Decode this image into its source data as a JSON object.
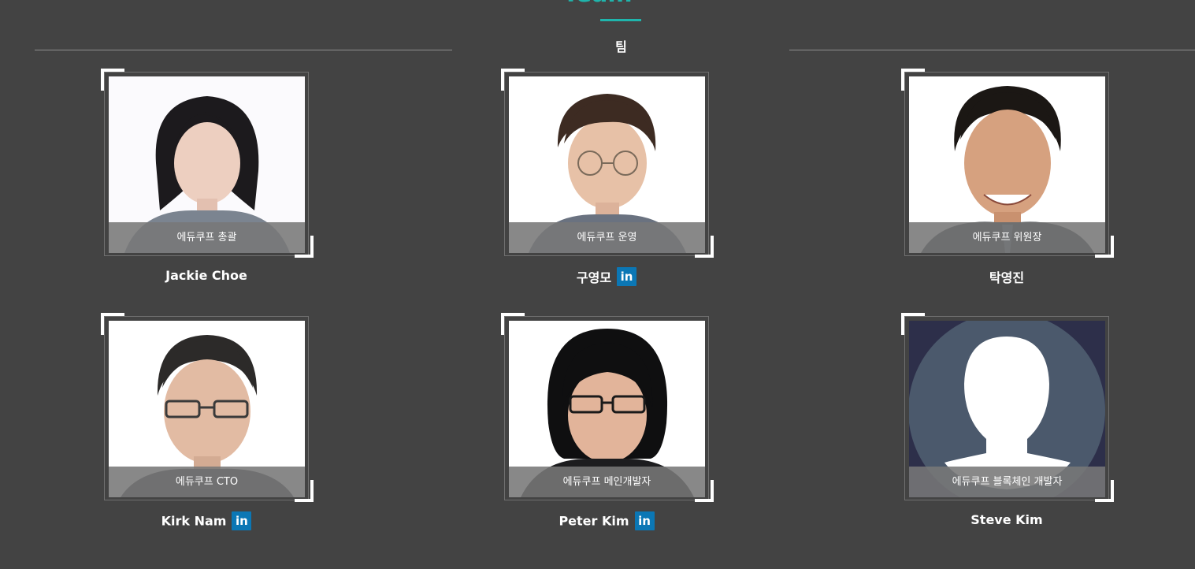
{
  "section": {
    "title": "Team",
    "subtitle": "팀"
  },
  "colors": {
    "background": "#434343",
    "accent": "#1fb5ac",
    "linkedin": "#0b77b5"
  },
  "members": [
    {
      "name": "Jackie Choe",
      "role": "에듀쿠프 총괄",
      "linkedin": false,
      "photo": "portrait-woman"
    },
    {
      "name": "구영모",
      "role": "에듀쿠프 운영",
      "linkedin": true,
      "linkedin_label": "in",
      "photo": "portrait-man-glasses"
    },
    {
      "name": "탁영진",
      "role": "에듀쿠프 위원장",
      "linkedin": false,
      "photo": "portrait-man-suit"
    },
    {
      "name": "Kirk Nam",
      "role": "에듀쿠프 CTO",
      "linkedin": true,
      "linkedin_label": "in",
      "photo": "portrait-man-glasses"
    },
    {
      "name": "Peter Kim",
      "role": "에듀쿠프 메인개발자",
      "linkedin": true,
      "linkedin_label": "in",
      "photo": "portrait-man-glasses-dark"
    },
    {
      "name": "Steve Kim",
      "role": "에듀쿠프 블록체인 개발자",
      "linkedin": false,
      "photo": "avatar-placeholder-icon"
    }
  ]
}
